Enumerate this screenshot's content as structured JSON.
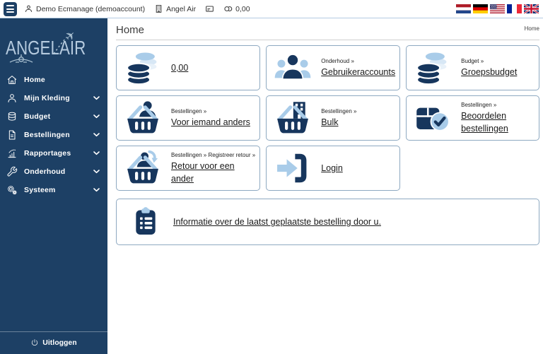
{
  "topbar": {
    "user_label": "Demo Ecmanage (demoaccount)",
    "company_label": "Angel Air",
    "balance_label": "0,00",
    "flags": [
      {
        "code": "nl",
        "label": "Nederlands"
      },
      {
        "code": "de",
        "label": "Deutsch"
      },
      {
        "code": "us",
        "label": "English (US)"
      },
      {
        "code": "fr",
        "label": "Français"
      },
      {
        "code": "gb",
        "label": "English (UK)"
      }
    ]
  },
  "sidebar": {
    "logo_text": "ANGELAIR",
    "items": [
      {
        "label": "Home",
        "icon": "home",
        "expandable": false
      },
      {
        "label": "Mijn Kleding",
        "icon": "user",
        "expandable": true
      },
      {
        "label": "Budget",
        "icon": "coins-outline",
        "expandable": true
      },
      {
        "label": "Bestellingen",
        "icon": "document",
        "expandable": true
      },
      {
        "label": "Rapportages",
        "icon": "chart",
        "expandable": true
      },
      {
        "label": "Onderhoud",
        "icon": "wrench",
        "expandable": true
      },
      {
        "label": "Systeem",
        "icon": "gears",
        "expandable": true
      }
    ],
    "logout_label": "Uitloggen"
  },
  "header": {
    "title": "Home",
    "breadcrumb": "Home"
  },
  "cards": [
    {
      "category": "",
      "title": "0,00",
      "icon": "coins"
    },
    {
      "category": "Onderhoud »",
      "title": "Gebruikeraccounts",
      "icon": "users"
    },
    {
      "category": "Budget »",
      "title": "Groepsbudget",
      "icon": "coins"
    },
    {
      "category": "Bestellingen »",
      "title": "Voor iemand anders",
      "icon": "basket-user"
    },
    {
      "category": "Bestellingen »",
      "title": "Bulk",
      "icon": "basket-building"
    },
    {
      "category": "Bestellingen »",
      "title": "Beoordelen bestellingen",
      "icon": "box-check"
    },
    {
      "category": "Bestellingen » Registreer retour »",
      "title": "Retour voor een ander",
      "icon": "basket-return"
    },
    {
      "category": "",
      "title": "Login",
      "icon": "login"
    }
  ],
  "info_card": {
    "title": "Informatie over de laatst geplaatste bestelling door u.",
    "icon": "clipboard"
  },
  "colors": {
    "navy": "#1d4065",
    "icon_navy": "#17365d",
    "light_blue": "#a9cce9",
    "ghost_blue": "#d7e7f5",
    "logo_blue": "#a7becf",
    "card_border": "#8ea9c1"
  }
}
